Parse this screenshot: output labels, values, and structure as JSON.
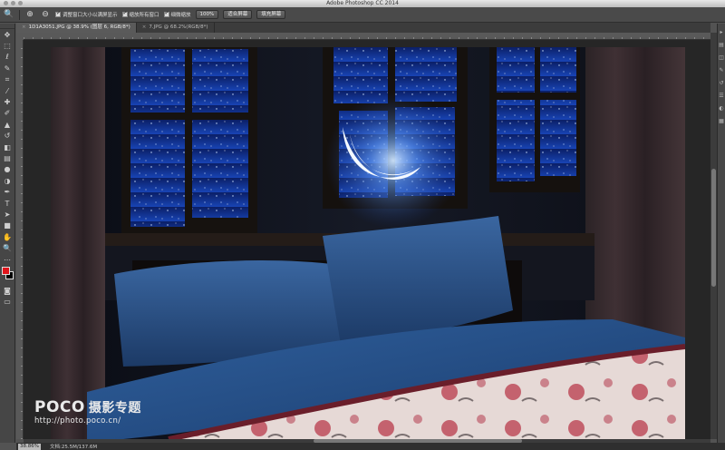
{
  "window": {
    "title": "Adobe Photoshop CC 2014"
  },
  "options_bar": {
    "resize_windows_label": "调整窗口大小以满屏显示",
    "zoom_all_windows_label": "缩放所有窗口",
    "scrubby_zoom_label": "细微缩放",
    "zoom_value": "100%",
    "fit_screen_button": "适合屏幕",
    "fill_screen_button": "填充屏幕"
  },
  "tabs": [
    {
      "label": "1D1A3051.JPG @ 38.9% (图层 6, RGB/8*)",
      "active": true
    },
    {
      "label": "7.JPG @ 68.2%(RGB/8*)",
      "active": false
    }
  ],
  "tools": [
    "move-icon",
    "marquee-icon",
    "lasso-icon",
    "quick-select-icon",
    "crop-icon",
    "eyedropper-icon",
    "healing-icon",
    "brush-icon",
    "stamp-icon",
    "history-brush-icon",
    "eraser-icon",
    "gradient-icon",
    "blur-icon",
    "dodge-icon",
    "pen-icon",
    "type-icon",
    "path-select-icon",
    "shape-icon",
    "hand-icon",
    "zoom-icon"
  ],
  "colors": {
    "foreground": "#e0141b",
    "background": "#000000"
  },
  "status_bar": {
    "zoom": "38.86%",
    "doc_info": "文档:25.5M/137.6M"
  },
  "watermark": {
    "logo": "POCO",
    "logo_sub": "摄影专题",
    "url": "http://photo.poco.cn/"
  }
}
